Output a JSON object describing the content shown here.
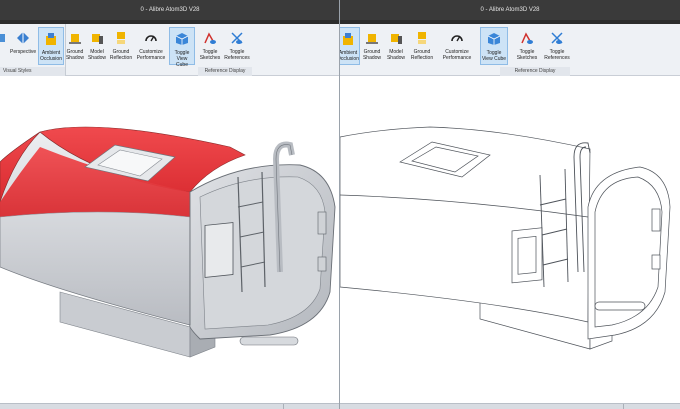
{
  "left_window": {
    "title": "0 - Alibre Atom3D V28",
    "buttons": [
      {
        "label": "",
        "icon": "view-icon"
      },
      {
        "label": "Perspective",
        "icon": "perspective-icon"
      },
      {
        "label": "Ambient Occlusion",
        "icon": "ambient-occlusion-icon",
        "active": true
      },
      {
        "label": "Ground Shadow",
        "icon": "ground-shadow-icon"
      },
      {
        "label": "Model Shadow",
        "icon": "model-shadow-icon"
      },
      {
        "label": "Ground Reflection",
        "icon": "ground-reflection-icon"
      },
      {
        "label": "Customize Performance",
        "icon": "customize-performance-icon"
      },
      {
        "label": "Toggle View Cube",
        "icon": "view-cube-icon",
        "active": true
      },
      {
        "label": "Toggle Sketches",
        "icon": "sketches-icon"
      },
      {
        "label": "Toggle References",
        "icon": "references-icon"
      }
    ],
    "groups": {
      "visual_styles": "Visual Styles",
      "reference_display": "Reference Display"
    }
  },
  "right_window": {
    "title": "0 - Alibre Atom3D V28",
    "buttons": [
      {
        "label": "Ambient Occlusion",
        "icon": "ambient-occlusion-icon",
        "active": true
      },
      {
        "label": "Ground Shadow",
        "icon": "ground-shadow-icon"
      },
      {
        "label": "Model Shadow",
        "icon": "model-shadow-icon"
      },
      {
        "label": "Ground Reflection",
        "icon": "ground-reflection-icon"
      },
      {
        "label": "Customize Performance",
        "icon": "customize-performance-icon"
      },
      {
        "label": "Toggle View Cube",
        "icon": "view-cube-icon",
        "active": true
      },
      {
        "label": "Toggle Sketches",
        "icon": "sketches-icon"
      },
      {
        "label": "Toggle References",
        "icon": "references-icon"
      }
    ],
    "groups": {
      "reference_display": "Reference Display"
    }
  },
  "colors": {
    "accent_red": "#e8363c",
    "body_gray": "#d9dbdf",
    "ribbon_bg": "#eef1f5",
    "titlebar_bg": "#3a3a3a"
  }
}
